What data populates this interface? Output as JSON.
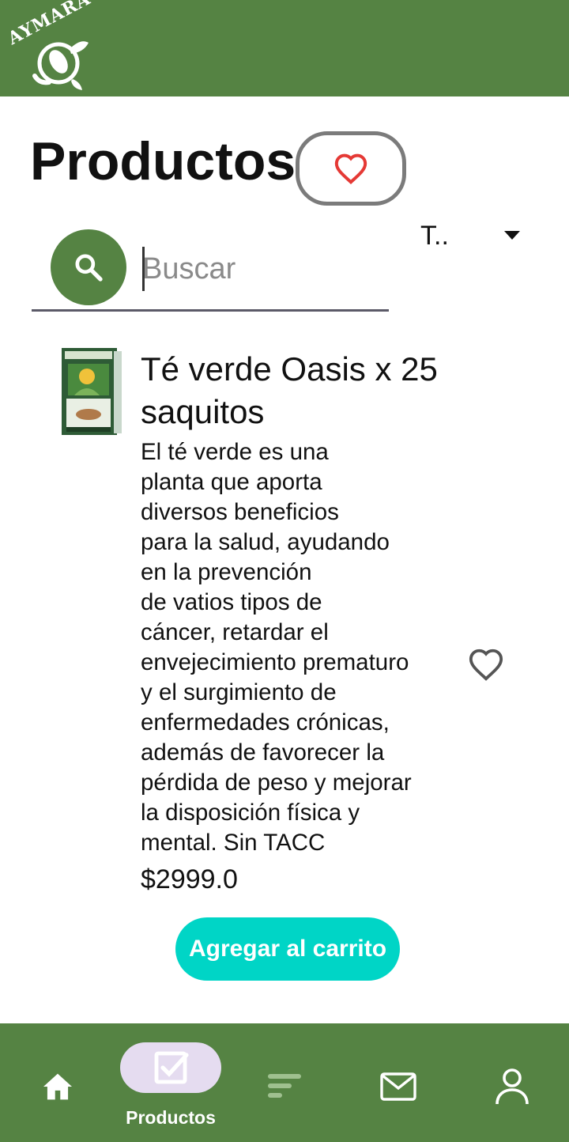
{
  "app": {
    "logo_text": "AYMARÁ"
  },
  "page": {
    "title": "Productos"
  },
  "sort": {
    "selected": "T.."
  },
  "search": {
    "placeholder": "Buscar",
    "value": ""
  },
  "product": {
    "name": "Té verde Oasis x 25 saquitos",
    "description": "El té verde es una\nplanta que aporta\ndiversos beneficios\npara la salud, ayudando\nen la prevención\nde vatios tipos de\ncáncer, retardar el\nenvejecimiento prematuro\ny el surgimiento de\nenfermedades crónicas,\nademás de favorecer la\npérdida de peso y mejorar\nla disposición física y\nmental. Sin TACC",
    "price": "$2999.0",
    "add_to_cart_label": "Agregar al carrito"
  },
  "bottom_nav": {
    "items": [
      {
        "icon": "home-icon"
      },
      {
        "icon": "checkbox-icon",
        "label": "Productos",
        "active": true
      },
      {
        "icon": "sort-lines-icon"
      },
      {
        "icon": "mail-icon"
      },
      {
        "icon": "user-icon"
      }
    ]
  },
  "colors": {
    "brand_green": "#558343",
    "cart_button": "#00d5c6",
    "heart_red": "#e53935",
    "active_pill": "#e5dcf0"
  }
}
